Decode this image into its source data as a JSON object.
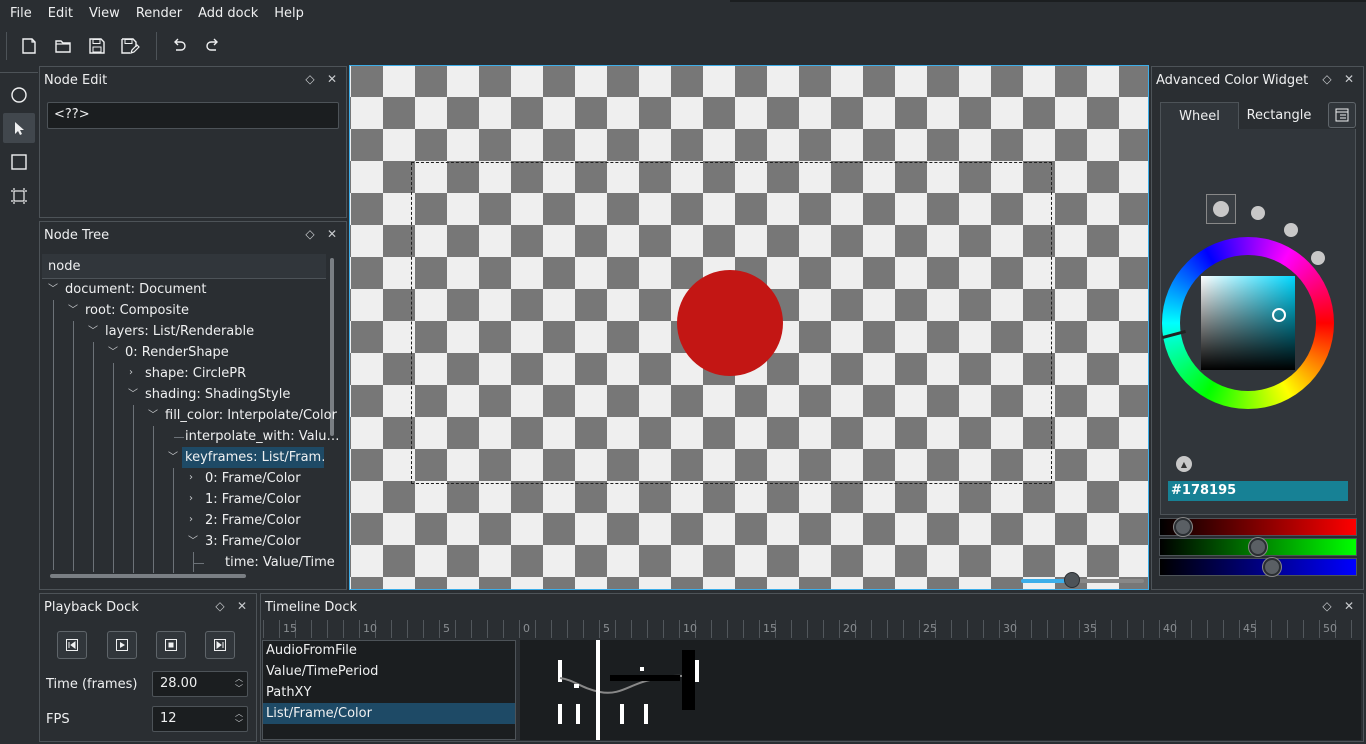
{
  "menu": [
    "File",
    "Edit",
    "View",
    "Render",
    "Add dock",
    "Help"
  ],
  "toolbar": {
    "icons": [
      "new-file-icon",
      "open-folder-icon",
      "save-icon",
      "save-as-icon",
      "undo-icon",
      "redo-icon"
    ]
  },
  "tools": [
    "ellipse-tool-icon",
    "select-tool-icon",
    "rectangle-tool-icon",
    "align-tool-icon"
  ],
  "node_edit": {
    "title": "Node Edit",
    "value": "<??>"
  },
  "node_tree": {
    "title": "Node Tree",
    "header": "node",
    "rows": [
      {
        "label": "document: Document"
      },
      {
        "label": "root: Composite"
      },
      {
        "label": "layers: List/Renderable"
      },
      {
        "label": "0: RenderShape"
      },
      {
        "label": "shape: CirclePR"
      },
      {
        "label": "shading: ShadingStyle"
      },
      {
        "label": "fill_color: Interpolate/Color"
      },
      {
        "label": "interpolate_with: Valu…"
      },
      {
        "label": "keyframes: List/Fram…"
      },
      {
        "label": "0: Frame/Color"
      },
      {
        "label": "1: Frame/Color"
      },
      {
        "label": "2: Frame/Color"
      },
      {
        "label": "3: Frame/Color"
      },
      {
        "label": "time: Value/Time"
      }
    ]
  },
  "color_widget": {
    "title": "Advanced Color Widget",
    "tabs": [
      "Wheel",
      "Rectangle"
    ],
    "active_tab": "Wheel",
    "hex": "#178195",
    "color": "#178195",
    "rgb": {
      "r": 23,
      "g": 129,
      "b": 149
    }
  },
  "canvas": {
    "circle_color": "#c31614",
    "accent": "#3daee9"
  },
  "playback": {
    "title": "Playback Dock",
    "buttons": [
      "skip-to-start-icon",
      "play-icon",
      "stop-icon",
      "skip-to-end-icon"
    ],
    "time_label": "Time (frames)",
    "time_value": "28.00",
    "fps_label": "FPS",
    "fps_value": "12"
  },
  "timeline": {
    "title": "Timeline Dock",
    "ticks": [
      "15",
      "10",
      "5",
      "0",
      "5",
      "10",
      "15",
      "20",
      "25",
      "30",
      "35",
      "40",
      "45",
      "50"
    ],
    "items": [
      "AudioFromFile",
      "Value/TimePeriod",
      "PathXY",
      "List/Frame/Color"
    ],
    "selected": "List/Frame/Color"
  }
}
